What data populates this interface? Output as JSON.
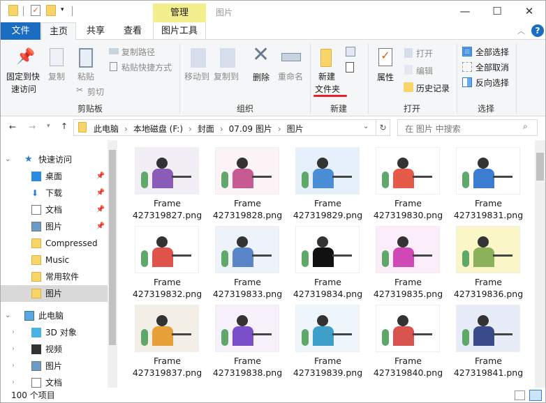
{
  "window": {
    "title": "图片",
    "context_tab": "管理",
    "minimize": "—",
    "maximize": "☐",
    "close": "✕"
  },
  "tabs": {
    "file": "文件",
    "home": "主页",
    "share": "共享",
    "view": "查看",
    "picture_tools": "图片工具"
  },
  "ribbon": {
    "clipboard": {
      "pin": "固定到快",
      "pin2": "速访问",
      "copy": "复制",
      "paste": "粘贴",
      "copy_path": "复制路径",
      "paste_shortcut": "粘贴快捷方式",
      "cut": "剪切",
      "group": "剪贴板"
    },
    "organize": {
      "move_to": "移动到",
      "copy_to": "复制到",
      "delete": "删除",
      "rename": "重命名",
      "group": "组织"
    },
    "new": {
      "new_folder": "新建",
      "new_folder2": "文件夹",
      "group": "新建"
    },
    "open": {
      "properties": "属性",
      "open": "打开",
      "edit": "编辑",
      "history": "历史记录",
      "group": "打开"
    },
    "select": {
      "select_all": "全部选择",
      "select_none": "全部取消",
      "invert": "反向选择",
      "group": "选择"
    }
  },
  "address": {
    "crumbs": [
      "此电脑",
      "本地磁盘 (F:)",
      "封面",
      "07.09 图片",
      "图片"
    ],
    "search_placeholder": "在 图片 中搜索"
  },
  "nav": [
    {
      "label": "快速访问",
      "icon": "star-icon",
      "pinned": false
    },
    {
      "label": "桌面",
      "icon": "desktop-icon",
      "pinned": true
    },
    {
      "label": "下载",
      "icon": "download-icon",
      "pinned": true
    },
    {
      "label": "文档",
      "icon": "document-icon",
      "pinned": true
    },
    {
      "label": "图片",
      "icon": "pictures-icon",
      "pinned": true
    },
    {
      "label": "Compressed",
      "icon": "folder-icon",
      "pinned": false
    },
    {
      "label": "Music",
      "icon": "folder-icon",
      "pinned": false
    },
    {
      "label": "常用软件",
      "icon": "folder-icon",
      "pinned": false
    },
    {
      "label": "图片",
      "icon": "folder-icon",
      "pinned": false
    },
    {
      "label": "此电脑",
      "icon": "computer-icon",
      "pinned": false
    },
    {
      "label": "3D 对象",
      "icon": "3d-icon",
      "pinned": false
    },
    {
      "label": "视频",
      "icon": "video-icon",
      "pinned": false
    },
    {
      "label": "图片",
      "icon": "pictures-icon",
      "pinned": false
    },
    {
      "label": "文档",
      "icon": "document-icon",
      "pinned": false
    }
  ],
  "files": [
    {
      "line1": "Frame",
      "line2": "427319827.png",
      "bg": "#f1eef5",
      "accent": "#8a5bb8"
    },
    {
      "line1": "Frame",
      "line2": "427319828.png",
      "bg": "#fbf3f6",
      "accent": "#c75a93"
    },
    {
      "line1": "Frame",
      "line2": "427319829.png",
      "bg": "#e5f0fb",
      "accent": "#4a8fd6"
    },
    {
      "line1": "Frame",
      "line2": "427319830.png",
      "bg": "#ffffff",
      "accent": "#e65a4a"
    },
    {
      "line1": "Frame",
      "line2": "427319831.png",
      "bg": "#ffffff",
      "accent": "#3c7dd1"
    },
    {
      "line1": "Frame",
      "line2": "427319832.png",
      "bg": "#ffffff",
      "accent": "#e0534a"
    },
    {
      "line1": "Frame",
      "line2": "427319833.png",
      "bg": "#eef3fb",
      "accent": "#5a86c9"
    },
    {
      "line1": "Frame",
      "line2": "427319834.png",
      "bg": "#ffffff",
      "accent": "#111111"
    },
    {
      "line1": "Frame",
      "line2": "427319835.png",
      "bg": "#fbeefa",
      "accent": "#d047b8"
    },
    {
      "line1": "Frame",
      "line2": "427319836.png",
      "bg": "#faf6c8",
      "accent": "#8bb25a"
    },
    {
      "line1": "Frame",
      "line2": "427319837.png",
      "bg": "#f4efe6",
      "accent": "#e6a03a"
    },
    {
      "line1": "Frame",
      "line2": "427319838.png",
      "bg": "#f6f0fb",
      "accent": "#7b4fc9"
    },
    {
      "line1": "Frame",
      "line2": "427319839.png",
      "bg": "#eef6fb",
      "accent": "#3ea0c9"
    },
    {
      "line1": "Frame",
      "line2": "427319840.png",
      "bg": "#ffffff",
      "accent": "#d9534f"
    },
    {
      "line1": "Frame",
      "line2": "427319841.png",
      "bg": "#e8ecf8",
      "accent": "#3a4a8a"
    }
  ],
  "status": {
    "count": "100 个项目"
  },
  "colors": {
    "accent": "#1a6dc0",
    "context": "#f3ef8c",
    "underline": "#e8212b"
  }
}
